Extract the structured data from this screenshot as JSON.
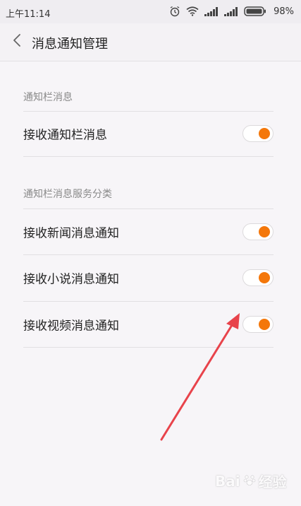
{
  "status_bar": {
    "time": "上午11:14",
    "battery": "98%",
    "icons": [
      "alarm-icon",
      "wifi-icon",
      "signal-icon",
      "signal-icon",
      "battery-icon"
    ]
  },
  "header": {
    "title": "消息通知管理",
    "back_icon": "chevron-left-icon"
  },
  "sections": [
    {
      "header": "通知栏消息",
      "items": [
        {
          "label": "接收通知栏消息",
          "enabled": true
        }
      ]
    },
    {
      "header": "通知栏消息服务分类",
      "items": [
        {
          "label": "接收新闻消息通知",
          "enabled": true
        },
        {
          "label": "接收小说消息通知",
          "enabled": true
        },
        {
          "label": "接收视频消息通知",
          "enabled": true
        }
      ]
    }
  ],
  "colors": {
    "accent": "#f4770a",
    "annotation_arrow": "#e8434b"
  },
  "watermark": {
    "text": "Bai",
    "suffix": "经验"
  }
}
